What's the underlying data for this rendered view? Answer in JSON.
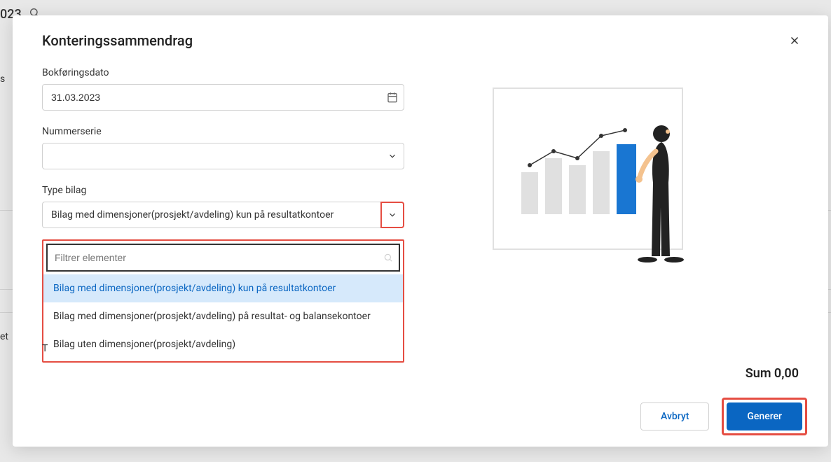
{
  "backdrop": {
    "titleFragment": "023",
    "rowLabel": "s",
    "rowLabel2": "et"
  },
  "modal": {
    "title": "Konteringssammendrag",
    "fields": {
      "bookingDate": {
        "label": "Bokføringsdato",
        "value": "31.03.2023"
      },
      "numberSeries": {
        "label": "Nummerserie",
        "value": ""
      },
      "voucherType": {
        "label": "Type bilag",
        "value": "Bilag med dimensjoner(prosjekt/avdeling) kun på resultatkontoer"
      }
    },
    "dropdown": {
      "filterPlaceholder": "Filtrer elementer",
      "options": [
        "Bilag med dimensjoner(prosjekt/avdeling) kun på resultatkontoer",
        "Bilag med dimensjoner(prosjekt/avdeling) på resultat- og balansekontoer",
        "Bilag uten dimensjoner(prosjekt/avdeling)"
      ]
    },
    "truncatedLabel": "T",
    "sumLabel": "Sum 0,00",
    "actions": {
      "cancel": "Avbryt",
      "generate": "Generer"
    }
  }
}
